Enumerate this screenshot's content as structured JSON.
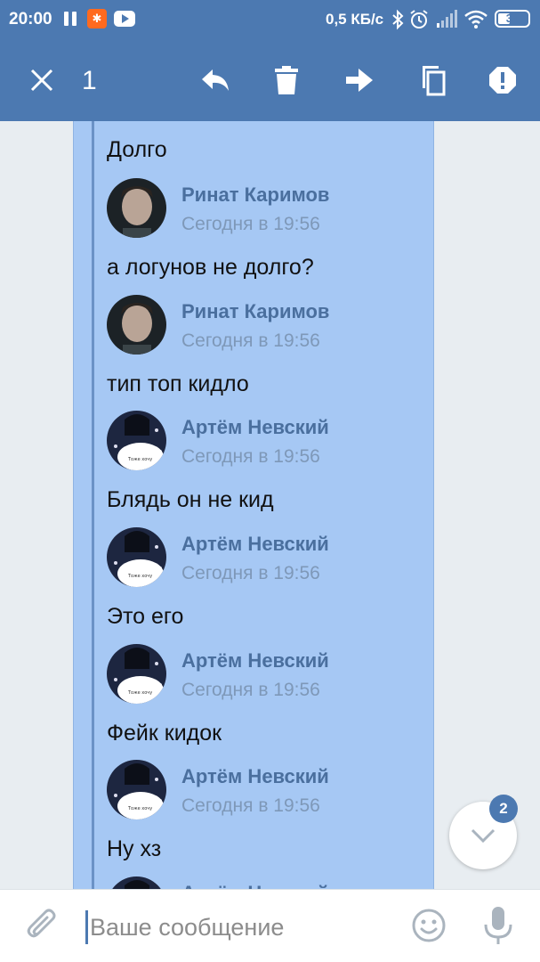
{
  "status_bar": {
    "time": "20:00",
    "app_icon_1": "notification-app-icon",
    "app_icon_2": "youtube-icon",
    "speed": "0,5 КБ/с",
    "battery": "34"
  },
  "action_bar": {
    "selected_count": "1",
    "icons": [
      "close-icon",
      "reply-icon",
      "trash-icon",
      "forward-icon",
      "copy-icon",
      "report-icon"
    ]
  },
  "messages": [
    {
      "text": "Долго"
    },
    {
      "author": "Ринат Каримов",
      "time": "Сегодня в 19:56",
      "text": "а логунов не долго?"
    },
    {
      "author": "Ринат Каримов",
      "time": "Сегодня в 19:56",
      "text": "тип топ кидло"
    },
    {
      "author": "Артём Невский",
      "time": "Сегодня в 19:56",
      "text": "Блядь он не кид"
    },
    {
      "author": "Артём Невский",
      "time": "Сегодня в 19:56",
      "text": "Это его"
    },
    {
      "author": "Артём Невский",
      "time": "Сегодня в 19:56",
      "text": "Фейк кидок"
    },
    {
      "author": "Артём Невский",
      "time": "Сегодня в 19:56",
      "text": "Ну хз"
    },
    {
      "author": "Артём Невский"
    }
  ],
  "scroll_fab": {
    "badge": "2"
  },
  "composer": {
    "placeholder": "Ваше сообщение"
  },
  "colors": {
    "header": "#4c79b1",
    "selection": "#a6c8f4",
    "author": "#4a6f9e"
  }
}
